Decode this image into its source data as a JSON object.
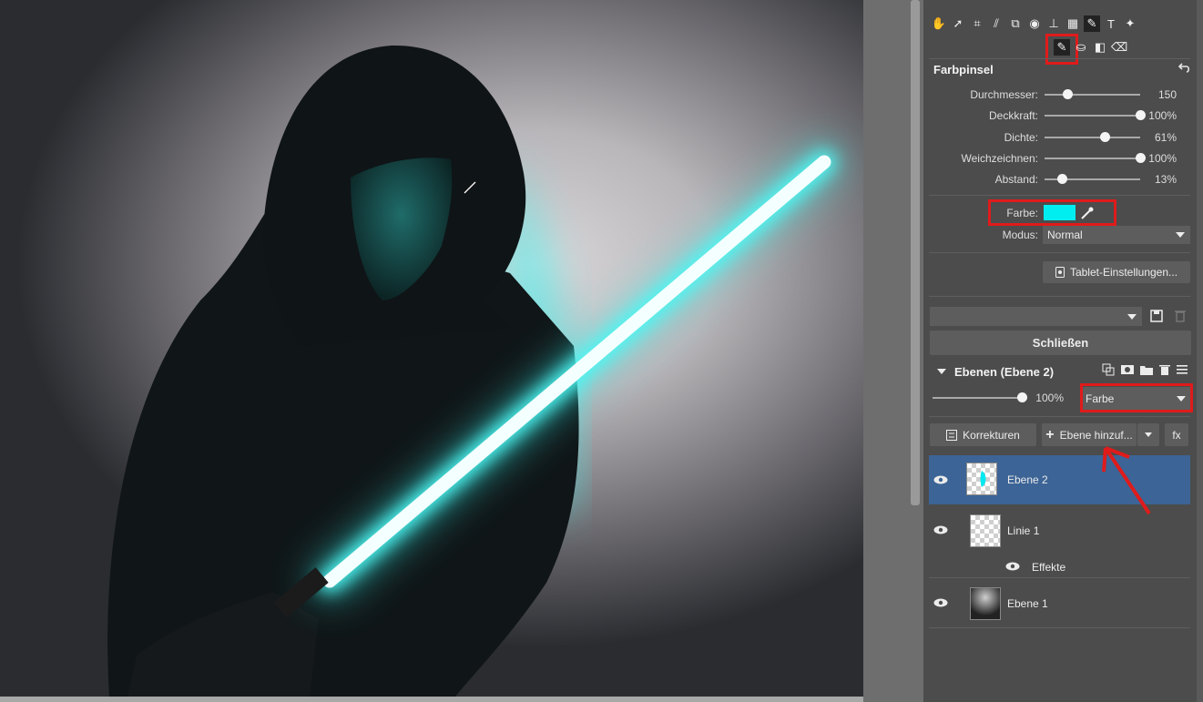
{
  "toolbar": {
    "tools_row1": [
      "hand-icon",
      "arrow-icon",
      "crop-icon",
      "perspective-icon",
      "transform-icon",
      "eye-icon",
      "stamp-icon",
      "grid-icon",
      "brush-icon",
      "text-icon",
      "wand-icon"
    ],
    "tools_row2": [
      "paintbrush-icon",
      "bucket-icon",
      "gradient-icon",
      "eraser-icon"
    ]
  },
  "brush_panel": {
    "title": "Farbpinsel",
    "sliders": [
      {
        "label": "Durchmesser:",
        "value_text": "150",
        "level": 0.19
      },
      {
        "label": "Deckkraft:",
        "value_text": "100%",
        "level": 1.0
      },
      {
        "label": "Dichte:",
        "value_text": "61%",
        "level": 0.61
      },
      {
        "label": "Weichzeichnen:",
        "value_text": "100%",
        "level": 1.0
      },
      {
        "label": "Abstand:",
        "value_text": "13%",
        "level": 0.13
      }
    ],
    "color_label": "Farbe:",
    "color_swatch": "#00eef0",
    "mode_label": "Modus:",
    "mode_value": "Normal",
    "tablet_button": "Tablet-Einstellungen..."
  },
  "preset": {
    "value": ""
  },
  "close_button": "Schließen",
  "layers": {
    "title": "Ebenen (Ebene 2)",
    "opacity_text": "100%",
    "opacity_level": 1.0,
    "blend_mode": "Farbe",
    "corrections_button": "Korrekturen",
    "add_layer_button": "Ebene hinzuf...",
    "fx_button": "fx",
    "items": [
      {
        "name": "Ebene 2",
        "selected": true
      },
      {
        "name": "Linie 1",
        "selected": false
      },
      {
        "name": "Effekte",
        "selected": false
      },
      {
        "name": "Ebene 1",
        "selected": false
      }
    ]
  },
  "colors": {
    "accent_red": "#e01b1b",
    "selection_blue": "#3c6496",
    "saber_cyan": "#39f5f0"
  }
}
